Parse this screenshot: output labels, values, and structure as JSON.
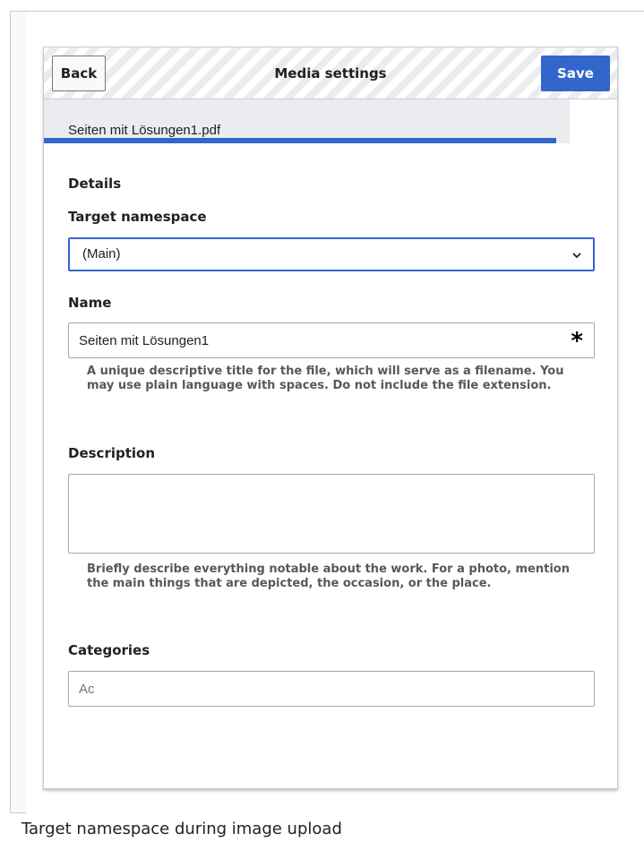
{
  "dialog": {
    "title": "Media settings",
    "back_label": "Back",
    "save_label": "Save",
    "file_name": "Seiten mit Lösungen1.pdf",
    "upload_progress": 1.0
  },
  "details": {
    "heading": "Details",
    "namespace": {
      "label": "Target namespace",
      "selected": "(Main)"
    },
    "name": {
      "label": "Name",
      "value": "Seiten mit Lösungen1",
      "required_marker": "*",
      "help": "A unique descriptive title for the file, which will serve as a filename. You may use plain language with spaces. Do not include the file extension."
    },
    "description": {
      "label": "Description",
      "value": "",
      "help": "Briefly describe everything notable about the work. For a photo, mention the main things that are depicted, the occasion, or the place."
    },
    "categories": {
      "label": "Categories",
      "placeholder": "Ac"
    }
  },
  "caption": "Target namespace during image upload",
  "colors": {
    "accent": "#3366cc",
    "border": "#a2a9b1",
    "help_text": "#54595d"
  }
}
